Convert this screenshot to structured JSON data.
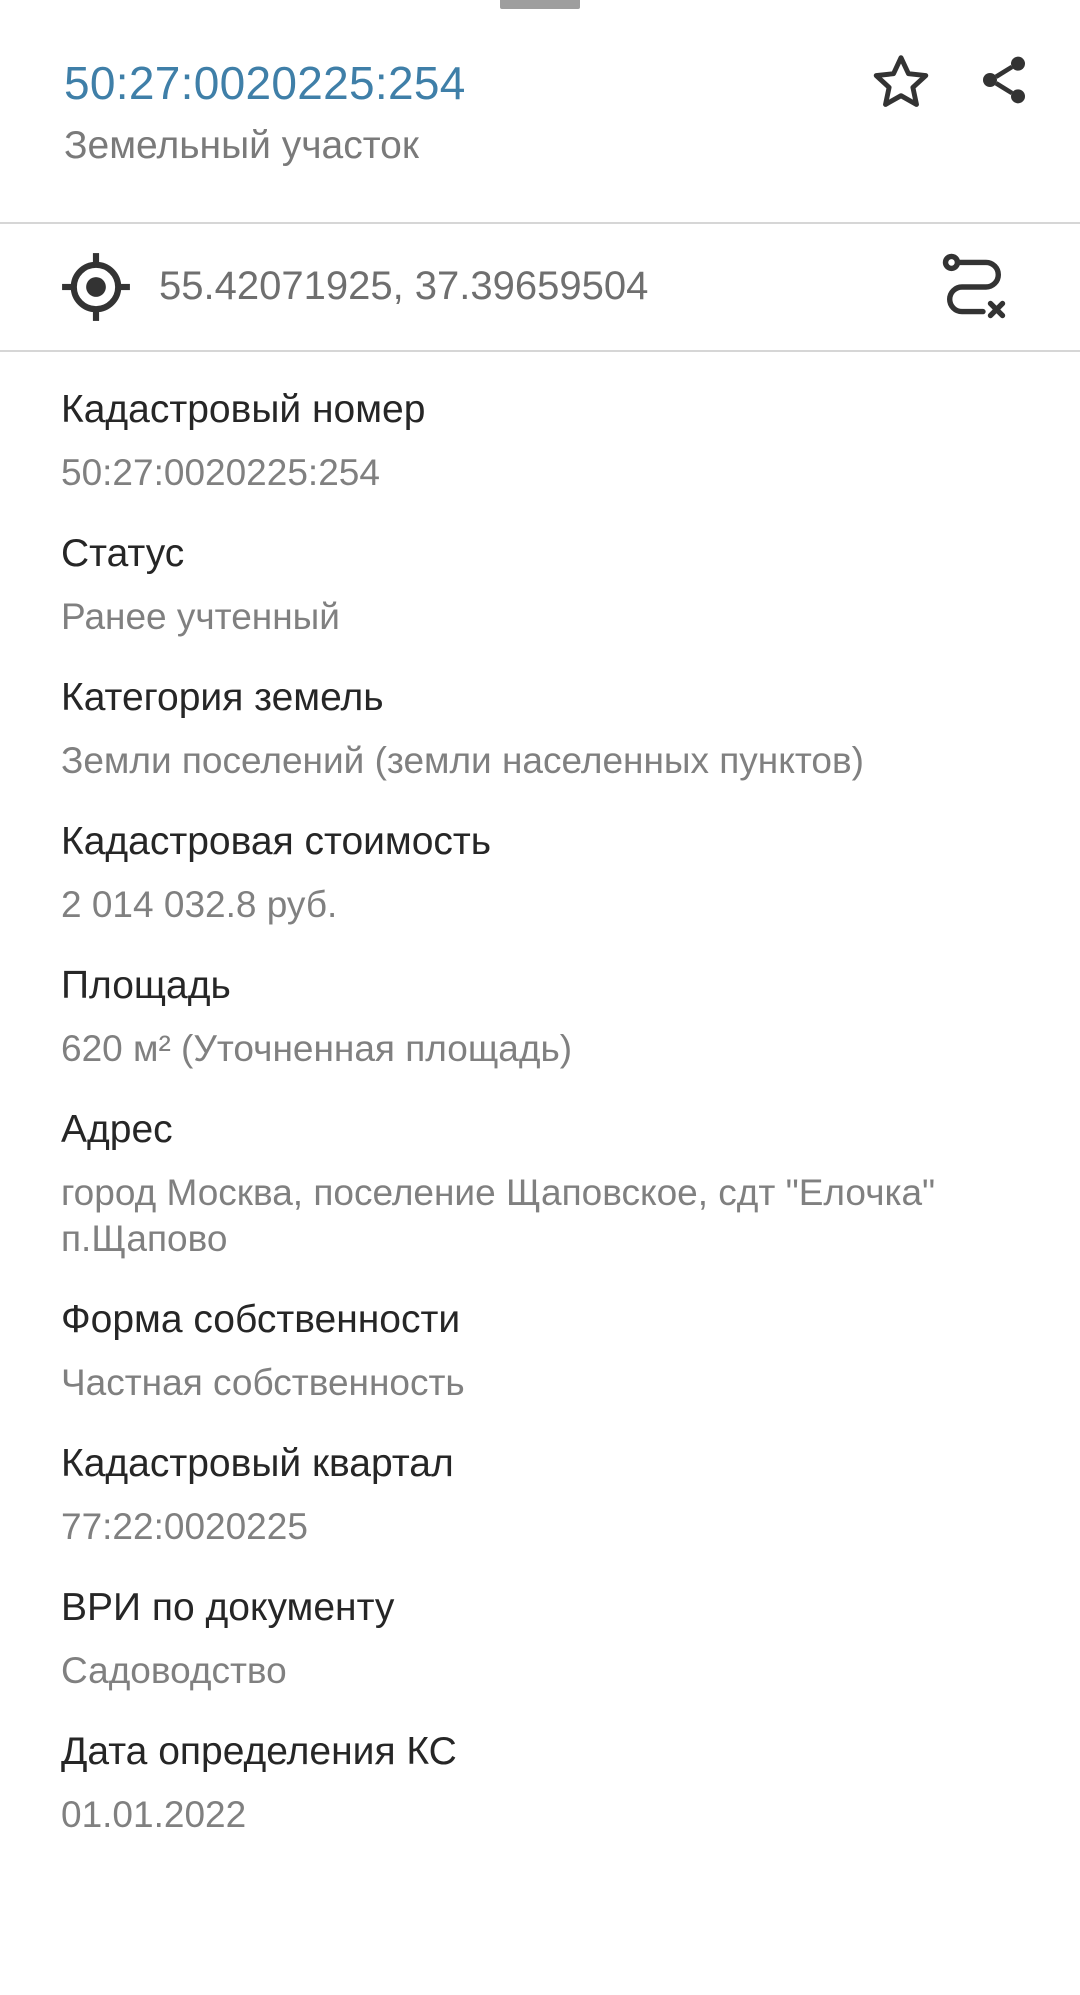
{
  "header": {
    "title": "50:27:0020225:254",
    "subtitle": "Земельный участок",
    "accent_color": "#3f7fa8",
    "actions": [
      {
        "icon": "star-icon",
        "label": "favorite"
      },
      {
        "icon": "share-icon",
        "label": "share"
      }
    ]
  },
  "location": {
    "icon": "crosshair-icon",
    "coords": "55.42071925, 37.39659504",
    "route_icon": "route-clear-icon"
  },
  "fields": [
    {
      "label": "Кадастровый номер",
      "value": "50:27:0020225:254"
    },
    {
      "label": "Статус",
      "value": "Ранее учтенный"
    },
    {
      "label": "Категория земель",
      "value": "Земли поселений (земли населенных пунктов)"
    },
    {
      "label": "Кадастровая стоимость",
      "value": "2 014 032.8 руб."
    },
    {
      "label": "Площадь",
      "value": "620 м² (Уточненная площадь)"
    },
    {
      "label": "Адрес",
      "value": "город Москва, поселение Щаповское, сдт \"Елочка\" п.Щапово"
    },
    {
      "label": "Форма собственности",
      "value": "Частная собственность"
    },
    {
      "label": "Кадастровый квартал",
      "value": "77:22:0020225"
    },
    {
      "label": "ВРИ по документу",
      "value": "Садоводство"
    },
    {
      "label": "Дата определения КС",
      "value": "01.01.2022"
    }
  ]
}
